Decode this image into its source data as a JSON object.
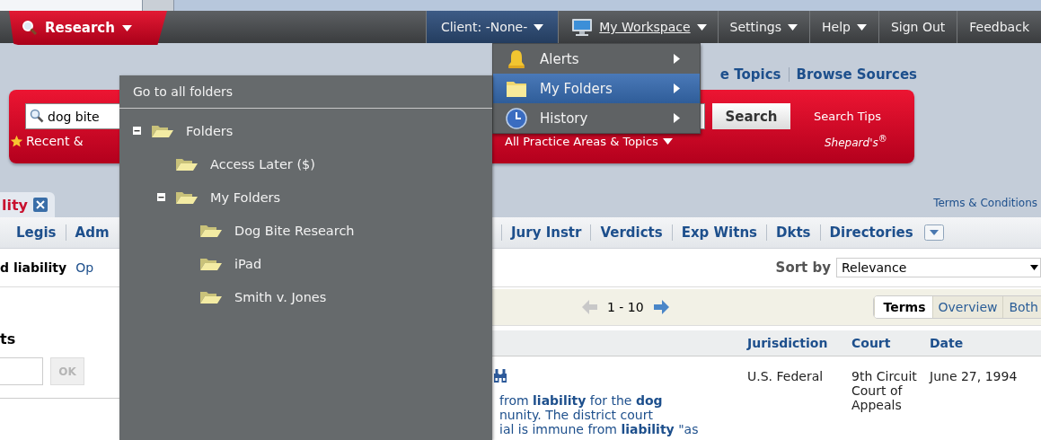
{
  "nav": {
    "research": "Research",
    "items": [
      {
        "kind": "client",
        "label": "Client: -None-",
        "dropdown": true
      },
      {
        "kind": "workspace",
        "label": "My Workspace",
        "dropdown": true
      },
      {
        "kind": "plain",
        "label": "Settings",
        "dropdown": true
      },
      {
        "kind": "plain",
        "label": "Help",
        "dropdown": true
      },
      {
        "kind": "plain",
        "label": "Sign Out",
        "dropdown": false
      },
      {
        "kind": "plain",
        "label": "Feedback",
        "dropdown": false
      }
    ]
  },
  "browse_links": [
    "e Topics",
    "Browse Sources"
  ],
  "search": {
    "value": "dog bite",
    "recent": "Recent &",
    "button": "Search",
    "tips": "Search Tips",
    "area": "All Practice Areas & Topics",
    "shepards": "Shepard's$^{®}$"
  },
  "result_tab": {
    "label": "lity"
  },
  "terms_link": "Terms & Conditions",
  "sources_left": [
    "Legis",
    "Adm"
  ],
  "sources_right": [
    "Jury Instr",
    "Verdicts",
    "Exp Witns",
    "Dkts",
    "Directories"
  ],
  "query": {
    "text": "d liability",
    "options": "Op"
  },
  "sort": {
    "label": "Sort by",
    "value": "Relevance"
  },
  "pager": {
    "range": "1 - 10",
    "prev_enabled": false,
    "next_enabled": true
  },
  "view_tabs": [
    {
      "label": "Terms",
      "selected": true
    },
    {
      "label": "Overview",
      "selected": false
    },
    {
      "label": "Both",
      "selected": false
    }
  ],
  "left_panel": {
    "heading": "ts",
    "ok": "OK",
    "ok_disabled": true
  },
  "columns": [
    "Jurisdiction",
    "Court",
    "Date"
  ],
  "results": [
    {
      "snippet": [
        "from **liability** for the **dog**",
        "nunity. The district court",
        "ial is immune from **liability** \"as"
      ],
      "jurisdiction": "U.S. Federal",
      "court": "9th Circuit Court of Appeals",
      "date": "June 27, 1994"
    }
  ],
  "workspace_menu": [
    {
      "label": "Alerts",
      "selected": false
    },
    {
      "label": "My Folders",
      "selected": true
    },
    {
      "label": "History",
      "selected": false
    }
  ],
  "folder_menu": {
    "header": "Go to all folders",
    "tree": [
      {
        "label": "Folders",
        "expanded": true,
        "children": [
          {
            "label": "Access Later ($)"
          },
          {
            "label": "My Folders",
            "expanded": true,
            "children": [
              {
                "label": "Dog Bite Research"
              },
              {
                "label": "iPad"
              },
              {
                "label": "Smith v. Jones"
              }
            ]
          }
        ]
      }
    ]
  }
}
